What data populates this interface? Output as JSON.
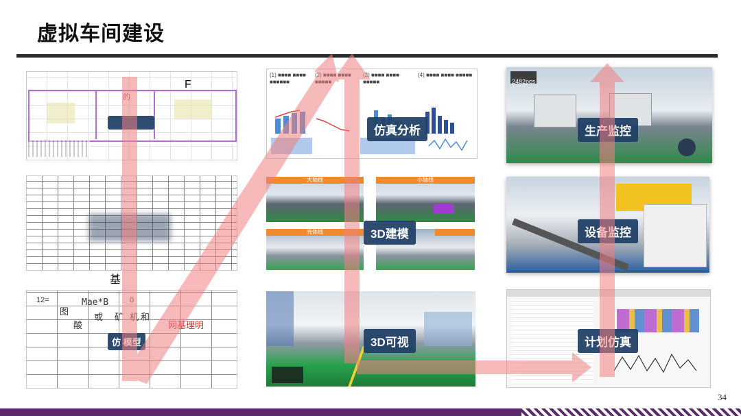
{
  "slide": {
    "title": "虚拟车间建设",
    "page_number": "34"
  },
  "left_column": {
    "top_tag": "",
    "top_marks": [
      "的",
      "F"
    ],
    "mid_caption": "基",
    "bottom_text": [
      "12=",
      "图",
      "Mae*B",
      "0",
      "酸",
      "或",
      "矿",
      "机",
      "和",
      "网基理明"
    ],
    "bottom_tag": "仿",
    "bottom_tag2": "模型"
  },
  "mid_column": {
    "charts_tag": "仿真分析",
    "model_tag": "3D建模",
    "visual_tag": "3D可视",
    "sub_labels": [
      "大轴线",
      "小轴线",
      "壳体线"
    ]
  },
  "right_column": {
    "monitor_tag": "生产监控",
    "device_tag": "设备监控",
    "plan_tag": "计划仿真",
    "counter": "2482pcs"
  },
  "colors": {
    "tag_bg": "#1f3f66",
    "arrow": "#f08080",
    "rule": "#2a2a2a",
    "footer": "#5a2a6a"
  }
}
